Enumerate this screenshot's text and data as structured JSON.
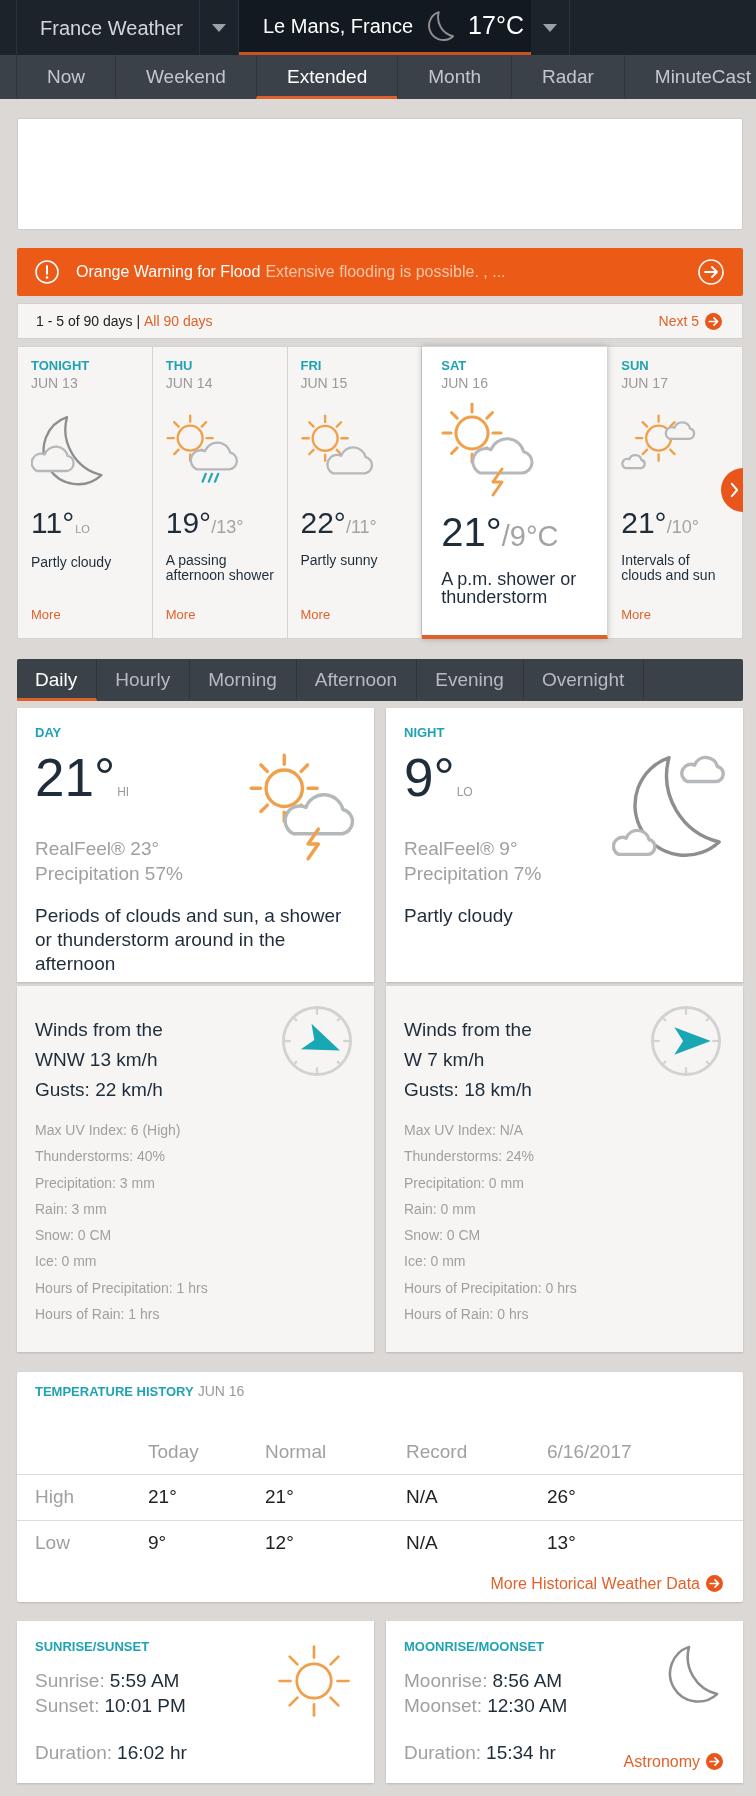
{
  "header": {
    "region": "France Weather",
    "location": "Le Mans, France",
    "current_temperature": "17°C"
  },
  "nav_tabs": [
    {
      "label": "Now",
      "selected": false
    },
    {
      "label": "Weekend",
      "selected": false
    },
    {
      "label": "Extended",
      "selected": true
    },
    {
      "label": "Month",
      "selected": false
    },
    {
      "label": "Radar",
      "selected": false
    },
    {
      "label": "MinuteCast",
      "selected": false
    }
  ],
  "alert": {
    "title": "Orange Warning for Flood",
    "detail": "Extensive flooding is possible. , ..."
  },
  "paging": {
    "range": "1 - 5 of 90 days |",
    "all_link": "All 90 days",
    "next_link": "Next 5"
  },
  "forecast_days": [
    {
      "day": "TONIGHT",
      "date": "JUN 13",
      "kind": "night",
      "temp": "11°",
      "tag": "LO",
      "description": "Partly cloudy",
      "more": "More",
      "selected": false
    },
    {
      "day": "THU",
      "date": "JUN 14",
      "kind": "showers",
      "temp": "19°",
      "low": "/13°",
      "description": "A passing afternoon shower",
      "more": "More",
      "selected": false
    },
    {
      "day": "FRI",
      "date": "JUN 15",
      "kind": "sunny",
      "temp": "22°",
      "low": "/11°",
      "description": "Partly sunny",
      "more": "More",
      "selected": false
    },
    {
      "day": "SAT",
      "date": "JUN 16",
      "kind": "storms",
      "temp": "21°",
      "low": "/9°C",
      "description": "A p.m. shower or thunderstorm",
      "selected": true
    },
    {
      "day": "SUN",
      "date": "JUN 17",
      "kind": "intervals",
      "temp": "21°",
      "low": "/10°",
      "description": "Intervals of clouds and sun",
      "more": "More",
      "selected": false
    }
  ],
  "period_tabs": [
    {
      "label": "Daily",
      "selected": true
    },
    {
      "label": "Hourly",
      "selected": false
    },
    {
      "label": "Morning",
      "selected": false
    },
    {
      "label": "Afternoon",
      "selected": false
    },
    {
      "label": "Evening",
      "selected": false
    },
    {
      "label": "Overnight",
      "selected": false
    }
  ],
  "panels": [
    {
      "heading": "DAY",
      "kind": "storms",
      "temp": "21°",
      "tag": "HI",
      "realfeel": "RealFeel® 23°",
      "precipitation": "Precipitation 57%",
      "description": "Periods of clouds and sun, a shower or thunderstorm around in the afternoon",
      "wind": {
        "kind": "ese",
        "text": "Winds from the WNW 13 km/h",
        "gusts": "Gusts: 22 km/h",
        "details": [
          "Max UV Index: 6 (High)",
          "Thunderstorms: 40%",
          "Precipitation: 3 mm",
          "Rain: 3 mm",
          "Snow: 0 CM",
          "Ice: 0 mm",
          "Hours of Precipitation: 1 hrs",
          "Hours of Rain: 1 hrs"
        ]
      }
    },
    {
      "heading": "NIGHT",
      "kind": "nightclouds",
      "temp": "9°",
      "tag": "LO",
      "realfeel": "RealFeel® 9°",
      "precipitation": "Precipitation 7%",
      "description": "Partly cloudy",
      "wind": {
        "kind": "e",
        "text": "Winds from the W 7 km/h",
        "gusts": "Gusts: 18 km/h",
        "details": [
          "Max UV Index: N/A",
          "Thunderstorms: 24%",
          "Precipitation: 0 mm",
          "Rain: 0 mm",
          "Snow: 0 CM",
          "Ice: 0 mm",
          "Hours of Precipitation: 0 hrs",
          "Hours of Rain: 0 hrs"
        ]
      }
    }
  ],
  "history": {
    "title": "TEMPERATURE HISTORY",
    "date": "JUN 16",
    "columns": [
      "Today",
      "Normal",
      "Record",
      "6/16/2017"
    ],
    "rows": [
      {
        "label": "High",
        "values": [
          "21°",
          "21°",
          "N/A",
          "26°"
        ]
      },
      {
        "label": "Low",
        "values": [
          "9°",
          "12°",
          "N/A",
          "13°"
        ]
      }
    ],
    "link": "More Historical Weather Data"
  },
  "astro": [
    {
      "title": "SUNRISE/SUNSET",
      "kind": "sun",
      "times": [
        {
          "label": "Sunrise:",
          "value": "5:59 AM"
        },
        {
          "label": "Sunset:",
          "value": "10:01 PM"
        }
      ],
      "duration": {
        "label": "Duration:",
        "value": "16:02 hr"
      }
    },
    {
      "title": "MOONRISE/MOONSET",
      "kind": "moon",
      "times": [
        {
          "label": "Moonrise:",
          "value": "8:56 AM"
        },
        {
          "label": "Moonset:",
          "value": "12:30 AM"
        }
      ],
      "duration": {
        "label": "Duration:",
        "value": "15:34 hr"
      },
      "link": "Astronomy"
    }
  ]
}
